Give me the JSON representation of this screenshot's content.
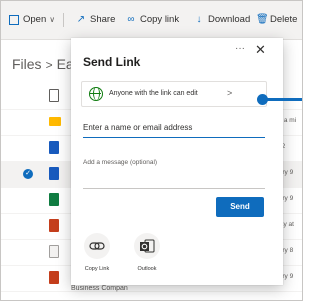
{
  "toolbar": {
    "open": "Open",
    "share": "Share",
    "copy_link": "Copy link",
    "download": "Download",
    "delete": "Delete"
  },
  "breadcrumb": {
    "root": "Files",
    "current": "Ea"
  },
  "rows": [
    {
      "meta": ""
    },
    {
      "meta": "out a mi"
    },
    {
      "meta": "y 22"
    },
    {
      "meta": "ruary 9"
    },
    {
      "meta": "ruary 9"
    },
    {
      "meta": "sday at"
    },
    {
      "meta": "ruary 8"
    },
    {
      "meta": "ruary 9",
      "name": "Business Compan"
    }
  ],
  "dialog": {
    "title": "Send Link",
    "more": "···",
    "close": "✕",
    "permission": "Anyone with the link can edit",
    "email_placeholder": "Enter a name or email address",
    "message_placeholder": "Add a message (optional)",
    "send": "Send",
    "copy_link": "Copy Link",
    "outlook": "Outlook"
  },
  "colors": {
    "accent": "#0f6cbd",
    "globe": "#107c10",
    "outlook": "#0f6cbd"
  }
}
